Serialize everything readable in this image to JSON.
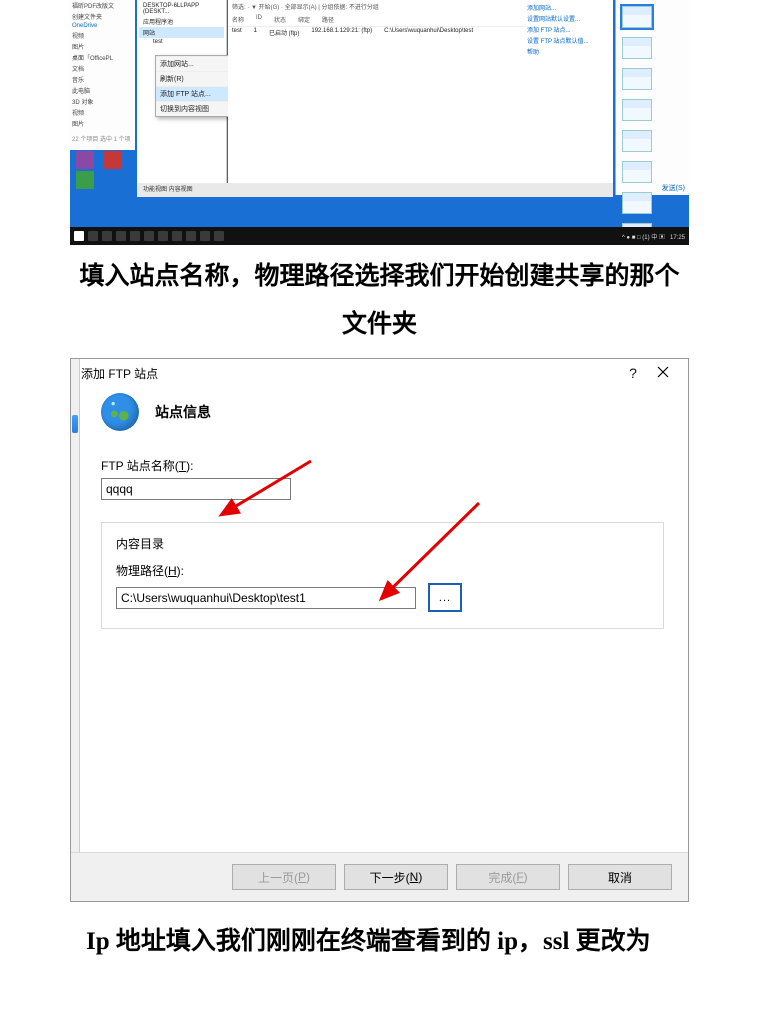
{
  "top_screenshot": {
    "left_panel": {
      "items": [
        "福昕PDF改版文",
        "创建文件夹",
        "OneDrive",
        "视频",
        "图片",
        "桌面「OfficePL",
        "文档",
        "音乐",
        "此电脑",
        "3D 对象",
        "视频",
        "图片"
      ],
      "status": "22 个项目   选中 1 个项"
    },
    "tree_panel": {
      "root": "DESKTOP-6LLPAPP (DESKT...",
      "node1": "应用程序池",
      "node2": "网站",
      "node3": "test"
    },
    "context_menu": {
      "item1": "添加网站...",
      "item2": "刷新(R)",
      "item3": "添加 FTP 站点...",
      "item4": "切换到内容视图"
    },
    "content_panel": {
      "toolbar": "筛选:    · ▼ 开始(G) · 全部显示(A) | 分组依据: 不进行分组",
      "headers": [
        "名称",
        "ID",
        "状态",
        "绑定",
        "路径"
      ],
      "row": {
        "name": "test",
        "id": "1",
        "status": "已启动 (ftp)",
        "binding": "192.168.1.129:21: (ftp)",
        "path": "C:\\Users\\wuquanhui\\Desktop\\test"
      },
      "footer": "功能视图   内容视图"
    },
    "right_actions": {
      "a1": "添加网站...",
      "a2": "设置网站默认设置...",
      "a3": "添加 FTP 站点...",
      "a4": "设置 FTP 站点默认值...",
      "a5": "帮助"
    },
    "thumbs_footer": "发送(S)",
    "taskbar": {
      "clock": "17:25",
      "tray": "^ ● ■ □ (1) 中 ▣"
    }
  },
  "caption1": "填入站点名称，物理路径选择我们开始创建共享的那个文件夹",
  "dialog": {
    "title": "添加 FTP 站点",
    "heading": "站点信息",
    "name_label_pre": "FTP 站点名称(",
    "name_label_acc": "T",
    "name_label_post": "):",
    "name_value": "qqqq",
    "content_dir_label": "内容目录",
    "path_label_pre": "物理路径(",
    "path_label_acc": "H",
    "path_label_post": "):",
    "path_value": "C:\\Users\\wuquanhui\\Desktop\\test1",
    "browse_label": "...",
    "buttons": {
      "prev_pre": "上一页(",
      "prev_acc": "P",
      "prev_post": ")",
      "next_pre": "下一步(",
      "next_acc": "N",
      "next_post": ")",
      "finish_pre": "完成(",
      "finish_acc": "F",
      "finish_post": ")",
      "cancel": "取消"
    }
  },
  "caption2": "Ip 地址填入我们刚刚在终端查看到的 ip，ssl 更改为"
}
